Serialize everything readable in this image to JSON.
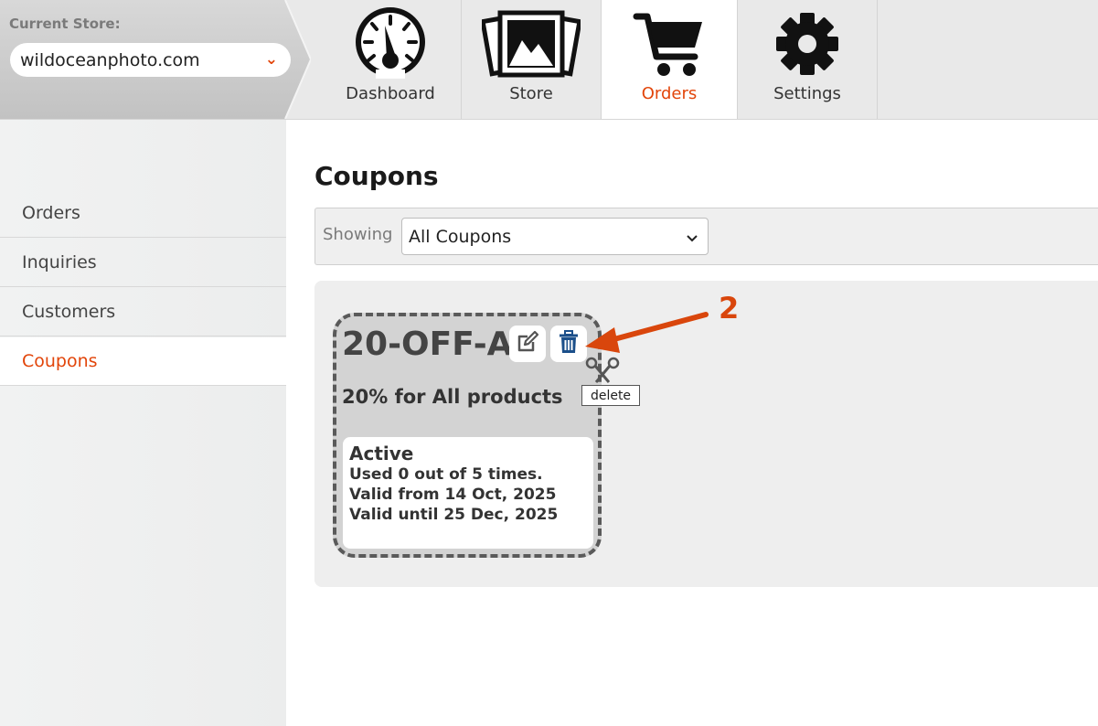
{
  "header": {
    "store_label": "Current Store:",
    "store_value": "wildoceanphoto.com",
    "tabs": [
      {
        "label": "Dashboard",
        "icon": "speedometer-icon",
        "active": false
      },
      {
        "label": "Store",
        "icon": "photos-icon",
        "active": false
      },
      {
        "label": "Orders",
        "icon": "shopping-cart-icon",
        "active": true
      },
      {
        "label": "Settings",
        "icon": "gear-icon",
        "active": false
      }
    ]
  },
  "sidebar": {
    "items": [
      {
        "label": "Orders",
        "active": false
      },
      {
        "label": "Inquiries",
        "active": false
      },
      {
        "label": "Customers",
        "active": false
      },
      {
        "label": "Coupons",
        "active": true
      }
    ]
  },
  "main": {
    "title": "Coupons",
    "filter": {
      "label": "Showing",
      "selected": "All Coupons"
    },
    "coupon": {
      "code": "20-OFF-ALL",
      "description": "20% for All products",
      "status": "Active",
      "usage": "Used 0 out of 5 times.",
      "valid_from": "Valid from 14 Oct, 2025",
      "valid_until": "Valid until 25 Dec, 2025",
      "edit_icon": "edit-icon",
      "delete_icon": "trash-icon",
      "tooltip": "delete"
    }
  },
  "annotation": {
    "number": "2",
    "color": "#d9460c"
  },
  "colors": {
    "accent": "#e2450a",
    "icon_blue": "#1b4f8a"
  }
}
